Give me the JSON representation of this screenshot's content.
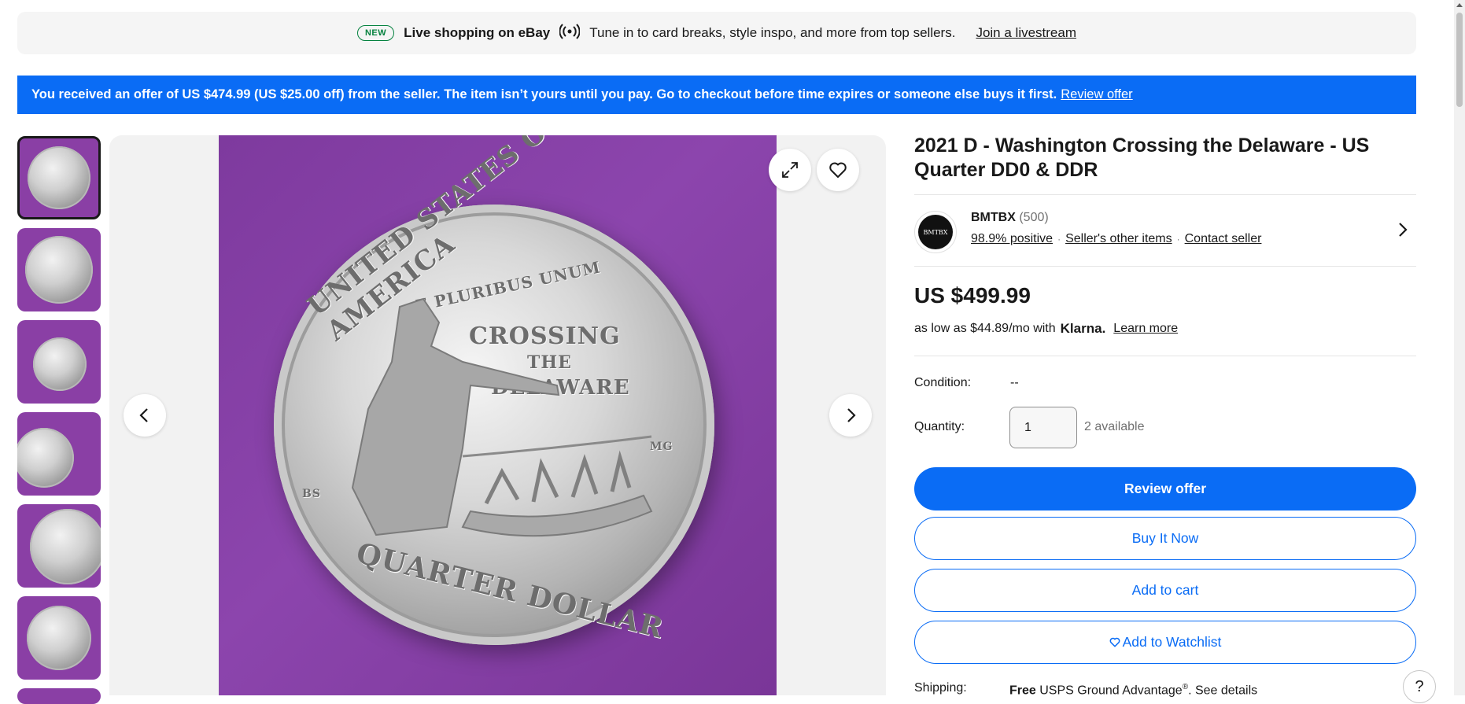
{
  "live_banner": {
    "badge": "NEW",
    "title": "Live shopping on eBay",
    "description": "Tune in to card breaks, style inspo, and more from top sellers.",
    "link": "Join a livestream"
  },
  "offer_banner": {
    "message": "You received an offer of US $474.99 (US $25.00 off) from the seller. The item isn’t yours until you pay. Go to checkout before time expires or someone else buys it first.",
    "link": "Review offer",
    "color": "#0a6cf5"
  },
  "gallery": {
    "thumbnail_count": 6,
    "coin_text": {
      "top": "UNITED STATES OF AMERICA",
      "motto": "E PLURIBUS UNUM",
      "center_1": "CROSSING",
      "center_2": "THE",
      "center_3": "DELAWARE",
      "bottom": "QUARTER DOLLAR",
      "initials_left": "BS",
      "initials_right": "MG"
    }
  },
  "listing": {
    "title": "2021 D - Washington Crossing the Delaware - US Quarter DD0 & DDR",
    "seller": {
      "logo_text": "BMTBX",
      "name": "BMTBX",
      "feedback_count": "(500)",
      "positive": "98.9% positive",
      "other_items": "Seller's other items",
      "contact": "Contact seller"
    },
    "price": "US $499.99",
    "klarna": {
      "prefix": "as low as $44.89/mo with",
      "brand": "Klarna.",
      "link": "Learn more"
    },
    "condition": {
      "label": "Condition:",
      "value": "--"
    },
    "quantity": {
      "label": "Quantity:",
      "value": "1",
      "available": "2 available"
    },
    "buttons": {
      "review_offer": "Review offer",
      "buy_now": "Buy It Now",
      "add_to_cart": "Add to cart",
      "add_to_watchlist": "Add to Watchlist"
    },
    "shipping": {
      "label": "Shipping:",
      "free": "Free",
      "service": "USPS Ground Advantage",
      "reg": "®",
      "details": ". See details"
    }
  },
  "help": {
    "label": "?"
  }
}
